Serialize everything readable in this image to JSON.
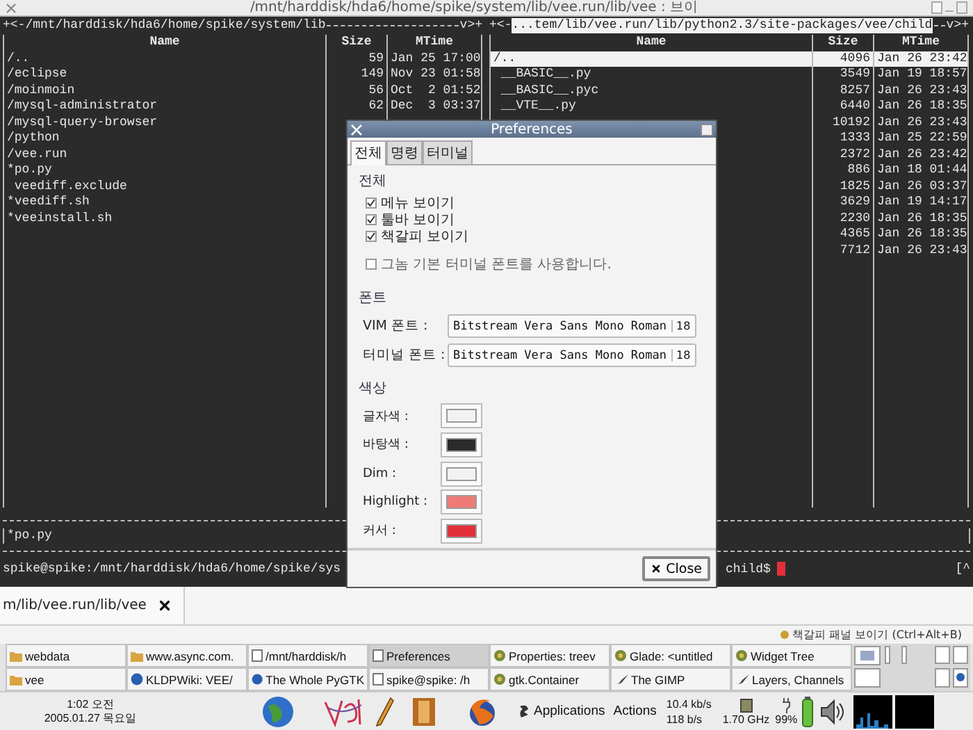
{
  "window": {
    "title": "/mnt/harddisk/hda6/home/spike/system/lib/vee.run/lib/vee : 브이"
  },
  "panes": [
    {
      "lead": "+<-",
      "path": "/mnt/harddisk/hda6/home/spike/system/lib",
      "tail": "v>+",
      "path_selected": false,
      "columns": [
        "Name",
        "Size",
        "MTime"
      ],
      "rows": [
        {
          "name": "/..",
          "size": "59",
          "mtime": "Jan 25 17:00",
          "selected": false
        },
        {
          "name": "/eclipse",
          "size": "149",
          "mtime": "Nov 23 01:58",
          "selected": false
        },
        {
          "name": "/moinmoin",
          "size": "56",
          "mtime": "Oct  2 01:52",
          "selected": false
        },
        {
          "name": "/mysql-administrator",
          "size": "62",
          "mtime": "Dec  3 03:37",
          "selected": false
        },
        {
          "name": "/mysql-query-browser",
          "selected": false
        },
        {
          "name": "/python",
          "selected": false
        },
        {
          "name": "/vee.run",
          "selected": false
        },
        {
          "name": "*po.py",
          "selected": false
        },
        {
          "name": " veediff.exclude",
          "selected": false
        },
        {
          "name": "*veediff.sh",
          "selected": false
        },
        {
          "name": "*veeinstall.sh",
          "selected": false
        }
      ]
    },
    {
      "lead": "+<-",
      "path": "...tem/lib/vee.run/lib/python2.3/site-packages/vee/child",
      "tail": "v>+",
      "path_selected": true,
      "columns": [
        "Name",
        "Size",
        "MTime"
      ],
      "rows": [
        {
          "name": "/..",
          "size": "4096",
          "mtime": "Jan 26 23:42",
          "selected": true
        },
        {
          "name": " __BASIC__.py",
          "size": "3549",
          "mtime": "Jan 19 18:57",
          "selected": false
        },
        {
          "name": " __BASIC__.pyc",
          "size": "8257",
          "mtime": "Jan 26 23:43",
          "selected": false
        },
        {
          "name": " __VTE__.py",
          "size": "6440",
          "mtime": "Jan 26 18:35",
          "selected": false
        },
        {
          "size": "10192",
          "mtime": "Jan 26 23:43",
          "selected": false
        },
        {
          "size": "1333",
          "mtime": "Jan 25 22:59",
          "selected": false
        },
        {
          "size": "2372",
          "mtime": "Jan 26 23:42",
          "selected": false
        },
        {
          "size": "886",
          "mtime": "Jan 18 01:44",
          "selected": false
        },
        {
          "size": "1825",
          "mtime": "Jan 26 03:37",
          "selected": false
        },
        {
          "size": "3629",
          "mtime": "Jan 19 14:17",
          "selected": false
        },
        {
          "size": "2230",
          "mtime": "Jan 26 18:35",
          "selected": false
        },
        {
          "size": "4365",
          "mtime": "Jan 26 18:35",
          "selected": false
        },
        {
          "size": "7712",
          "mtime": "Jan 26 23:43",
          "selected": false
        }
      ]
    }
  ],
  "command_line": {
    "text": "*po.py"
  },
  "prompt": {
    "text": "spike@spike:/mnt/harddisk/hda6/home/spike/sys",
    "tail": "child$",
    "right": "[^"
  },
  "tabs": [
    {
      "label": "m/lib/vee.run/lib/vee",
      "selected": true
    }
  ],
  "status_bar": {
    "hint": "책갈피 패널 보이기 (Ctrl+Alt+B)"
  },
  "dialog": {
    "title": "Preferences",
    "tabs": [
      {
        "label": "전체",
        "selected": true
      },
      {
        "label": "명령",
        "selected": false
      },
      {
        "label": "터미널",
        "selected": false
      }
    ],
    "general": {
      "heading": "전체",
      "options": [
        {
          "label": "메뉴 보이기",
          "checked": true
        },
        {
          "label": "툴바 보이기",
          "checked": true
        },
        {
          "label": "책갈피 보이기",
          "checked": true
        },
        {
          "label": "그놈 기본 터미널 폰트를 사용합니다.",
          "checked": false
        }
      ]
    },
    "fonts": {
      "heading": "폰트",
      "items": [
        {
          "label": "VIM 폰트 :",
          "font": "Bitstream Vera Sans Mono Roman",
          "size": "18"
        },
        {
          "label": "터미널 폰트 :",
          "font": "Bitstream Vera Sans Mono Roman",
          "size": "18"
        }
      ]
    },
    "colors": {
      "heading": "색상",
      "items": [
        {
          "label": "글자색 :",
          "color": "#f2f2f2"
        },
        {
          "label": "바탕색 :",
          "color": "#2b2b2b"
        },
        {
          "label": "Dim :",
          "color": "#f2f2f2"
        },
        {
          "label": "Highlight :",
          "color": "#f07a78"
        },
        {
          "label": "커서 :",
          "color": "#e2303a"
        }
      ]
    },
    "close": "Close"
  },
  "taskbar": {
    "rows": [
      [
        {
          "label": "webdata",
          "kind": "folder",
          "selected": false
        },
        {
          "label": "www.async.com.",
          "kind": "folder",
          "selected": false
        },
        {
          "label": "/mnt/harddisk/h",
          "kind": "page",
          "selected": false
        },
        {
          "label": "Preferences",
          "kind": "page",
          "selected": true
        },
        {
          "label": "Properties: treev",
          "kind": "glade",
          "selected": false
        },
        {
          "label": "Glade: <untitled",
          "kind": "glade",
          "selected": false
        },
        {
          "label": "Widget Tree",
          "kind": "glade",
          "selected": false
        }
      ],
      [
        {
          "label": "vee",
          "kind": "folder",
          "selected": false
        },
        {
          "label": "KLDPWiki: VEE/",
          "kind": "globe",
          "selected": false
        },
        {
          "label": "The Whole PyGTK",
          "kind": "globe",
          "selected": false
        },
        {
          "label": "spike@spike: /h",
          "kind": "page",
          "selected": false
        },
        {
          "label": "gtk.Container",
          "kind": "glade",
          "selected": false
        },
        {
          "label": "The GIMP",
          "kind": "brush",
          "selected": false
        },
        {
          "label": "Layers, Channels",
          "kind": "brush",
          "selected": false
        }
      ]
    ],
    "clock": {
      "time": "1:02 오전",
      "date": "2005.01.27 목요일"
    },
    "menus": [
      "Applications",
      "Actions"
    ],
    "network": {
      "down": "10.4 kb/s",
      "up": "118 b/s"
    },
    "cpu": "1.70 GHz",
    "battery": "99%"
  }
}
